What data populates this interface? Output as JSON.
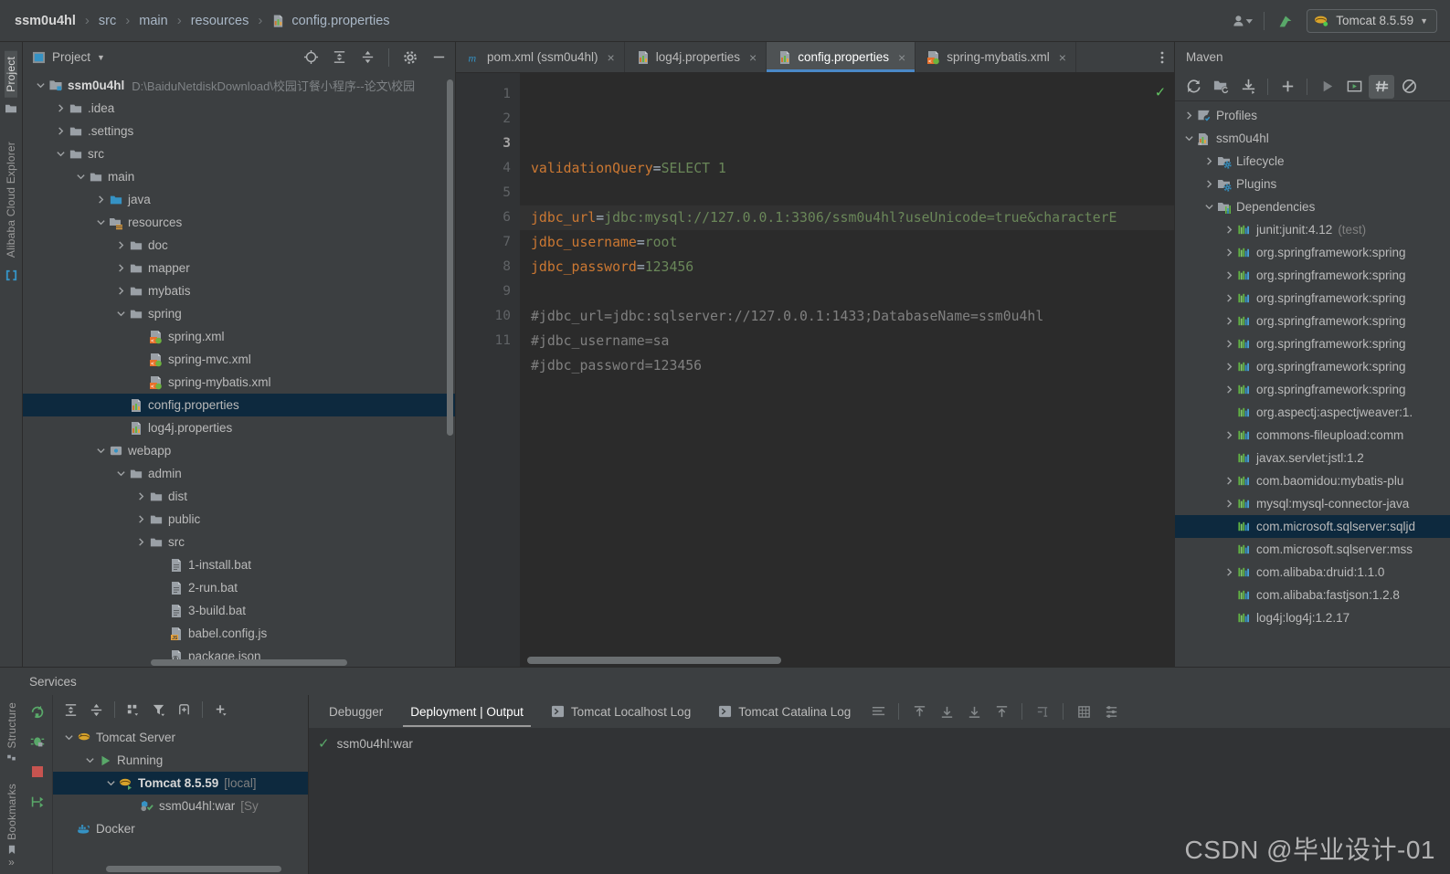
{
  "window": {
    "breadcrumb": [
      {
        "label": "ssm0u4hl",
        "bold": true
      },
      {
        "label": "src",
        "bold": false
      },
      {
        "label": "main",
        "bold": false
      },
      {
        "label": "resources",
        "bold": false
      },
      {
        "label": "config.properties",
        "bold": false,
        "icon": "properties-file-icon"
      }
    ],
    "separator": "›",
    "account_icon": "user-account-icon",
    "update_icon": "green-arrow-update-icon",
    "run_config": {
      "label": "Tomcat 8.5.59",
      "icon": "tomcat-icon",
      "caret": "▼"
    }
  },
  "left_strip": {
    "items": [
      {
        "label": "Project",
        "icon": "project-folder-icon",
        "active": true
      },
      {
        "label": "Alibaba Cloud Explorer",
        "icon": "cloud-bracket-icon",
        "active": false
      }
    ],
    "bottom_items": [
      {
        "label": "Structure",
        "icon": "structure-icon"
      },
      {
        "label": "Bookmarks",
        "icon": "bookmark-icon"
      }
    ]
  },
  "project_panel": {
    "title": "Project",
    "title_caret": "▼",
    "toolbar_icons": [
      "locate-target-icon",
      "expand-all-icon",
      "collapse-all-icon",
      "settings-gear-icon",
      "hide-minus-icon"
    ],
    "tree": [
      {
        "indent": 0,
        "arrow": "down",
        "icon": "module-icon",
        "label": "ssm0u4hl",
        "bold": true,
        "path": "D:\\BaiduNetdiskDownload\\校园订餐小程序--论文\\校园"
      },
      {
        "indent": 1,
        "arrow": "right",
        "icon": "folder-icon",
        "label": ".idea"
      },
      {
        "indent": 1,
        "arrow": "right",
        "icon": "folder-icon",
        "label": ".settings"
      },
      {
        "indent": 1,
        "arrow": "down",
        "icon": "folder-icon",
        "label": "src"
      },
      {
        "indent": 2,
        "arrow": "down",
        "icon": "folder-icon",
        "label": "main"
      },
      {
        "indent": 3,
        "arrow": "right",
        "icon": "source-folder-icon",
        "label": "java"
      },
      {
        "indent": 3,
        "arrow": "down",
        "icon": "resource-folder-icon",
        "label": "resources"
      },
      {
        "indent": 4,
        "arrow": "right",
        "icon": "folder-icon",
        "label": "doc"
      },
      {
        "indent": 4,
        "arrow": "right",
        "icon": "folder-icon",
        "label": "mapper"
      },
      {
        "indent": 4,
        "arrow": "right",
        "icon": "folder-icon",
        "label": "mybatis"
      },
      {
        "indent": 4,
        "arrow": "down",
        "icon": "folder-icon",
        "label": "spring"
      },
      {
        "indent": 5,
        "arrow": "none",
        "icon": "spring-xml-icon",
        "label": "spring.xml"
      },
      {
        "indent": 5,
        "arrow": "none",
        "icon": "spring-xml-icon",
        "label": "spring-mvc.xml"
      },
      {
        "indent": 5,
        "arrow": "none",
        "icon": "spring-xml-icon",
        "label": "spring-mybatis.xml"
      },
      {
        "indent": 4,
        "arrow": "none",
        "icon": "properties-file-icon",
        "label": "config.properties",
        "selected": true
      },
      {
        "indent": 4,
        "arrow": "none",
        "icon": "properties-file-icon",
        "label": "log4j.properties"
      },
      {
        "indent": 3,
        "arrow": "down",
        "icon": "webapp-folder-icon",
        "label": "webapp"
      },
      {
        "indent": 4,
        "arrow": "down",
        "icon": "folder-icon",
        "label": "admin"
      },
      {
        "indent": 5,
        "arrow": "right",
        "icon": "folder-icon",
        "label": "dist"
      },
      {
        "indent": 5,
        "arrow": "right",
        "icon": "folder-icon",
        "label": "public"
      },
      {
        "indent": 5,
        "arrow": "right",
        "icon": "folder-icon",
        "label": "src"
      },
      {
        "indent": 6,
        "arrow": "none",
        "icon": "bat-file-icon",
        "label": "1-install.bat"
      },
      {
        "indent": 6,
        "arrow": "none",
        "icon": "bat-file-icon",
        "label": "2-run.bat"
      },
      {
        "indent": 6,
        "arrow": "none",
        "icon": "bat-file-icon",
        "label": "3-build.bat"
      },
      {
        "indent": 6,
        "arrow": "none",
        "icon": "js-file-icon",
        "label": "babel.config.js"
      },
      {
        "indent": 6,
        "arrow": "none",
        "icon": "json-file-icon",
        "label": "package.json"
      }
    ]
  },
  "editor": {
    "tabs": [
      {
        "label": "pom.xml (ssm0u4hl)",
        "icon": "maven-m-icon",
        "active": false,
        "close": "×"
      },
      {
        "label": "log4j.properties",
        "icon": "properties-file-icon",
        "active": false,
        "close": "×"
      },
      {
        "label": "config.properties",
        "icon": "properties-file-icon",
        "active": true,
        "close": "×"
      },
      {
        "label": "spring-mybatis.xml",
        "icon": "spring-xml-icon",
        "active": false,
        "close": "×"
      }
    ],
    "more_icon": "vertical-dots-icon",
    "line_numbers": [
      "1",
      "2",
      "3",
      "4",
      "5",
      "6",
      "7",
      "8",
      "9",
      "10",
      "11"
    ],
    "current_line": 3,
    "inspection_status": "ok-check-icon",
    "lines": [
      {
        "n": 1,
        "key": "validationQuery",
        "eq": "=",
        "val": "SELECT 1",
        "type": "prop"
      },
      {
        "n": 2,
        "type": "blank"
      },
      {
        "n": 3,
        "key": "jdbc_url",
        "eq": "=",
        "val": "jdbc:mysql://127.0.0.1:3306/ssm0u4hl?useUnicode=true&characterE",
        "type": "prop",
        "highlight": true
      },
      {
        "n": 4,
        "key": "jdbc_username",
        "eq": "=",
        "val": "root",
        "type": "prop"
      },
      {
        "n": 5,
        "key": "jdbc_password",
        "eq": "=",
        "val": "123456",
        "type": "prop"
      },
      {
        "n": 6,
        "type": "blank"
      },
      {
        "n": 7,
        "text": "#jdbc_url=jdbc:sqlserver://127.0.0.1:1433;DatabaseName=ssm0u4hl",
        "type": "comment"
      },
      {
        "n": 8,
        "text": "#jdbc_username=sa",
        "type": "comment"
      },
      {
        "n": 9,
        "text": "#jdbc_password=123456",
        "type": "comment"
      },
      {
        "n": 10,
        "type": "blank"
      },
      {
        "n": 11,
        "type": "blank"
      }
    ]
  },
  "maven": {
    "title": "Maven",
    "toolbar_icons": [
      "reload-icon",
      "add-maven-project-icon",
      "download-sources-icon",
      "plus-icon",
      "run-icon",
      "execute-goal-icon",
      "toggle-offline-icon",
      "skip-tests-icon"
    ],
    "tree": [
      {
        "indent": 0,
        "arrow": "right",
        "icon": "profiles-icon",
        "label": "Profiles"
      },
      {
        "indent": 0,
        "arrow": "down",
        "icon": "maven-project-icon",
        "label": "ssm0u4hl"
      },
      {
        "indent": 1,
        "arrow": "right",
        "icon": "lifecycle-folder-icon",
        "label": "Lifecycle"
      },
      {
        "indent": 1,
        "arrow": "right",
        "icon": "plugins-folder-icon",
        "label": "Plugins"
      },
      {
        "indent": 1,
        "arrow": "down",
        "icon": "dependencies-folder-icon",
        "label": "Dependencies"
      },
      {
        "indent": 2,
        "arrow": "right",
        "icon": "dependency-icon",
        "label": "junit:junit:4.12",
        "suffix": "(test)"
      },
      {
        "indent": 2,
        "arrow": "right",
        "icon": "dependency-icon",
        "label": "org.springframework:spring"
      },
      {
        "indent": 2,
        "arrow": "right",
        "icon": "dependency-icon",
        "label": "org.springframework:spring"
      },
      {
        "indent": 2,
        "arrow": "right",
        "icon": "dependency-icon",
        "label": "org.springframework:spring"
      },
      {
        "indent": 2,
        "arrow": "right",
        "icon": "dependency-icon",
        "label": "org.springframework:spring"
      },
      {
        "indent": 2,
        "arrow": "right",
        "icon": "dependency-icon",
        "label": "org.springframework:spring"
      },
      {
        "indent": 2,
        "arrow": "right",
        "icon": "dependency-icon",
        "label": "org.springframework:spring"
      },
      {
        "indent": 2,
        "arrow": "right",
        "icon": "dependency-icon",
        "label": "org.springframework:spring"
      },
      {
        "indent": 2,
        "arrow": "none",
        "icon": "dependency-icon",
        "label": "org.aspectj:aspectjweaver:1."
      },
      {
        "indent": 2,
        "arrow": "right",
        "icon": "dependency-icon",
        "label": "commons-fileupload:comm"
      },
      {
        "indent": 2,
        "arrow": "none",
        "icon": "dependency-icon",
        "label": "javax.servlet:jstl:1.2"
      },
      {
        "indent": 2,
        "arrow": "right",
        "icon": "dependency-icon",
        "label": "com.baomidou:mybatis-plu"
      },
      {
        "indent": 2,
        "arrow": "right",
        "icon": "dependency-icon",
        "label": "mysql:mysql-connector-java"
      },
      {
        "indent": 2,
        "arrow": "none",
        "icon": "dependency-icon",
        "label": "com.microsoft.sqlserver:sqljd",
        "selected": true
      },
      {
        "indent": 2,
        "arrow": "none",
        "icon": "dependency-icon",
        "label": "com.microsoft.sqlserver:mss"
      },
      {
        "indent": 2,
        "arrow": "right",
        "icon": "dependency-icon",
        "label": "com.alibaba:druid:1.1.0"
      },
      {
        "indent": 2,
        "arrow": "none",
        "icon": "dependency-icon",
        "label": "com.alibaba:fastjson:1.2.8"
      },
      {
        "indent": 2,
        "arrow": "none",
        "icon": "dependency-icon",
        "label": "log4j:log4j:1.2.17"
      }
    ]
  },
  "services": {
    "title": "Services",
    "run_column_icons": [
      "rerun-icon",
      "debug-icon",
      "stop-icon",
      "settings-flow-icon"
    ],
    "toolbar_icons": [
      "expand-all-icon",
      "collapse-all-icon",
      "group-by-icon",
      "filter-icon",
      "add-frame-icon",
      "add-service-icon"
    ],
    "tree": [
      {
        "indent": 0,
        "arrow": "down",
        "icon": "tomcat-icon",
        "label": "Tomcat Server"
      },
      {
        "indent": 1,
        "arrow": "down",
        "icon": "running-play-icon",
        "label": "Running"
      },
      {
        "indent": 2,
        "arrow": "down",
        "icon": "tomcat-running-icon",
        "label": "Tomcat 8.5.59",
        "suffix": "[local]",
        "bold": true,
        "selected": true
      },
      {
        "indent": 3,
        "arrow": "none",
        "icon": "artifact-deployed-icon",
        "label": "ssm0u4hl:war",
        "suffix": "[Sy"
      },
      {
        "indent": 0,
        "arrow": "none",
        "icon": "docker-icon",
        "label": "Docker"
      }
    ],
    "tabs": [
      {
        "label": "Debugger",
        "active": false
      },
      {
        "label": "Deployment | Output",
        "active": true
      },
      {
        "label": "Tomcat Localhost Log",
        "icon": "console-icon",
        "active": false
      },
      {
        "label": "Tomcat Catalina Log",
        "icon": "console-icon",
        "active": false
      }
    ],
    "tab_right_icons": [
      "soft-wrap-icon",
      "scroll-up-icon",
      "scroll-down-icon",
      "scroll-to-end-icon",
      "scroll-to-top-icon",
      "jump-cursor-icon",
      "table-icon",
      "settings-lines-icon"
    ],
    "output": [
      {
        "icon": "green-check-icon",
        "label": "ssm0u4hl:war"
      }
    ]
  },
  "watermark": {
    "text": "CSDN @毕业设计-01"
  }
}
